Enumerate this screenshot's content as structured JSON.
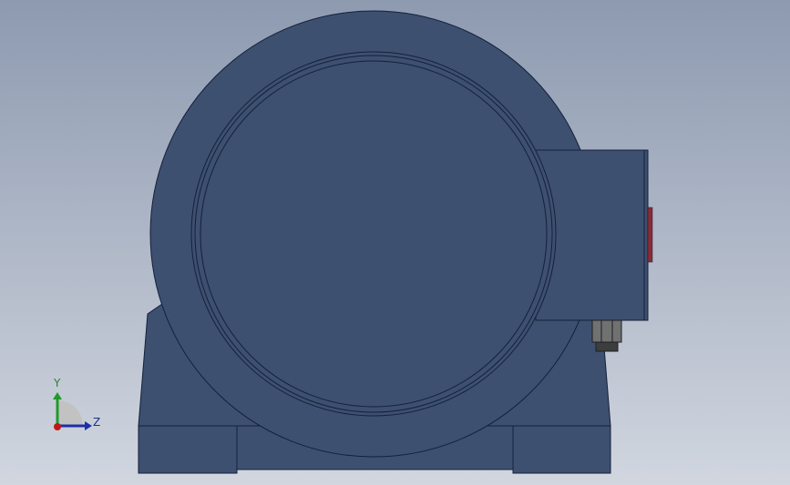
{
  "scene": {
    "model": "motor",
    "view": "front",
    "colors": {
      "background_top": "#8e9bb1",
      "background_bottom": "#d0d5de",
      "body": "#3d5070",
      "edge": "#15203a",
      "terminal_accent": "#b03030",
      "bolt": "#6f7270",
      "bolt_dark": "#3b3d3e"
    }
  },
  "triad": {
    "y_label": "Y",
    "z_label": "Z",
    "colors": {
      "y_axis": "#1f9a2a",
      "z_axis": "#1d2fa8",
      "x_axis": "#c01818",
      "plane": "#c8c8c8"
    }
  }
}
